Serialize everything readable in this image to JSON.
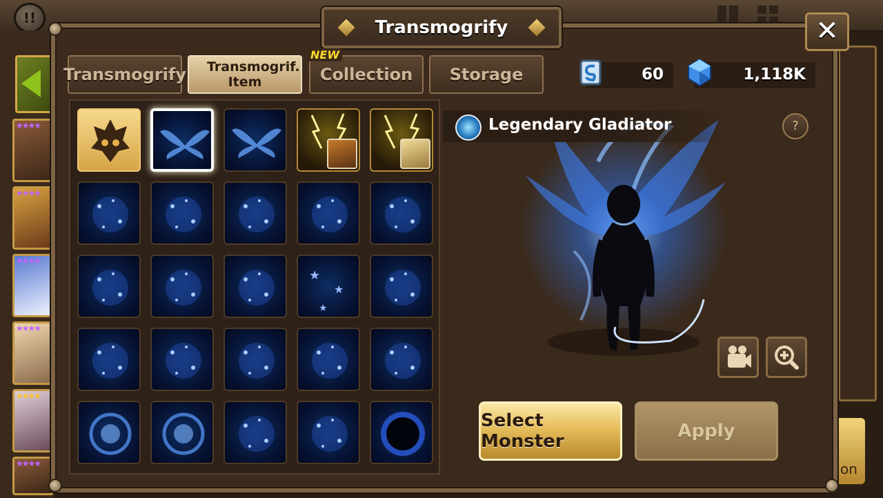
{
  "background": {
    "chat_icon": "!!",
    "right_button_label": "on"
  },
  "modal": {
    "title": "Transmogrify",
    "close_icon": "✕"
  },
  "tabs": [
    {
      "label": "Transmogrify",
      "active": false
    },
    {
      "label": "Transmogrif. Item",
      "active": true
    },
    {
      "label": "Collection",
      "active": false,
      "badge": "NEW"
    },
    {
      "label": "Storage",
      "active": false
    }
  ],
  "currencies": [
    {
      "name": "transmog-scroll-icon",
      "value": "60"
    },
    {
      "name": "crystal-icon",
      "value": "1,118K"
    }
  ],
  "grid": {
    "rows": 5,
    "columns": 5,
    "selected_index": 1,
    "items": [
      "gold-crest",
      "wings-blue-1",
      "wings-blue-2",
      "lightning-portrait-1",
      "lightning-portrait-2",
      "glow-burst",
      "sparkle-cloud",
      "sparkle-dust",
      "blue-fire",
      "blue-smoke",
      "blue-mist",
      "blue-hearts",
      "blue-bubbles",
      "blue-stars",
      "blue-twinkle",
      "blue-aura",
      "blue-rain",
      "blue-flame-swirl",
      "blue-wisps",
      "blue-feathers",
      "blue-vortex",
      "blue-orb",
      "blue-mandala",
      "blue-thorns",
      "dark-ring"
    ]
  },
  "preview": {
    "item_name": "Legendary Gladiator",
    "help_icon": "?"
  },
  "buttons": {
    "select_monster": "Select Monster",
    "apply": "Apply"
  }
}
